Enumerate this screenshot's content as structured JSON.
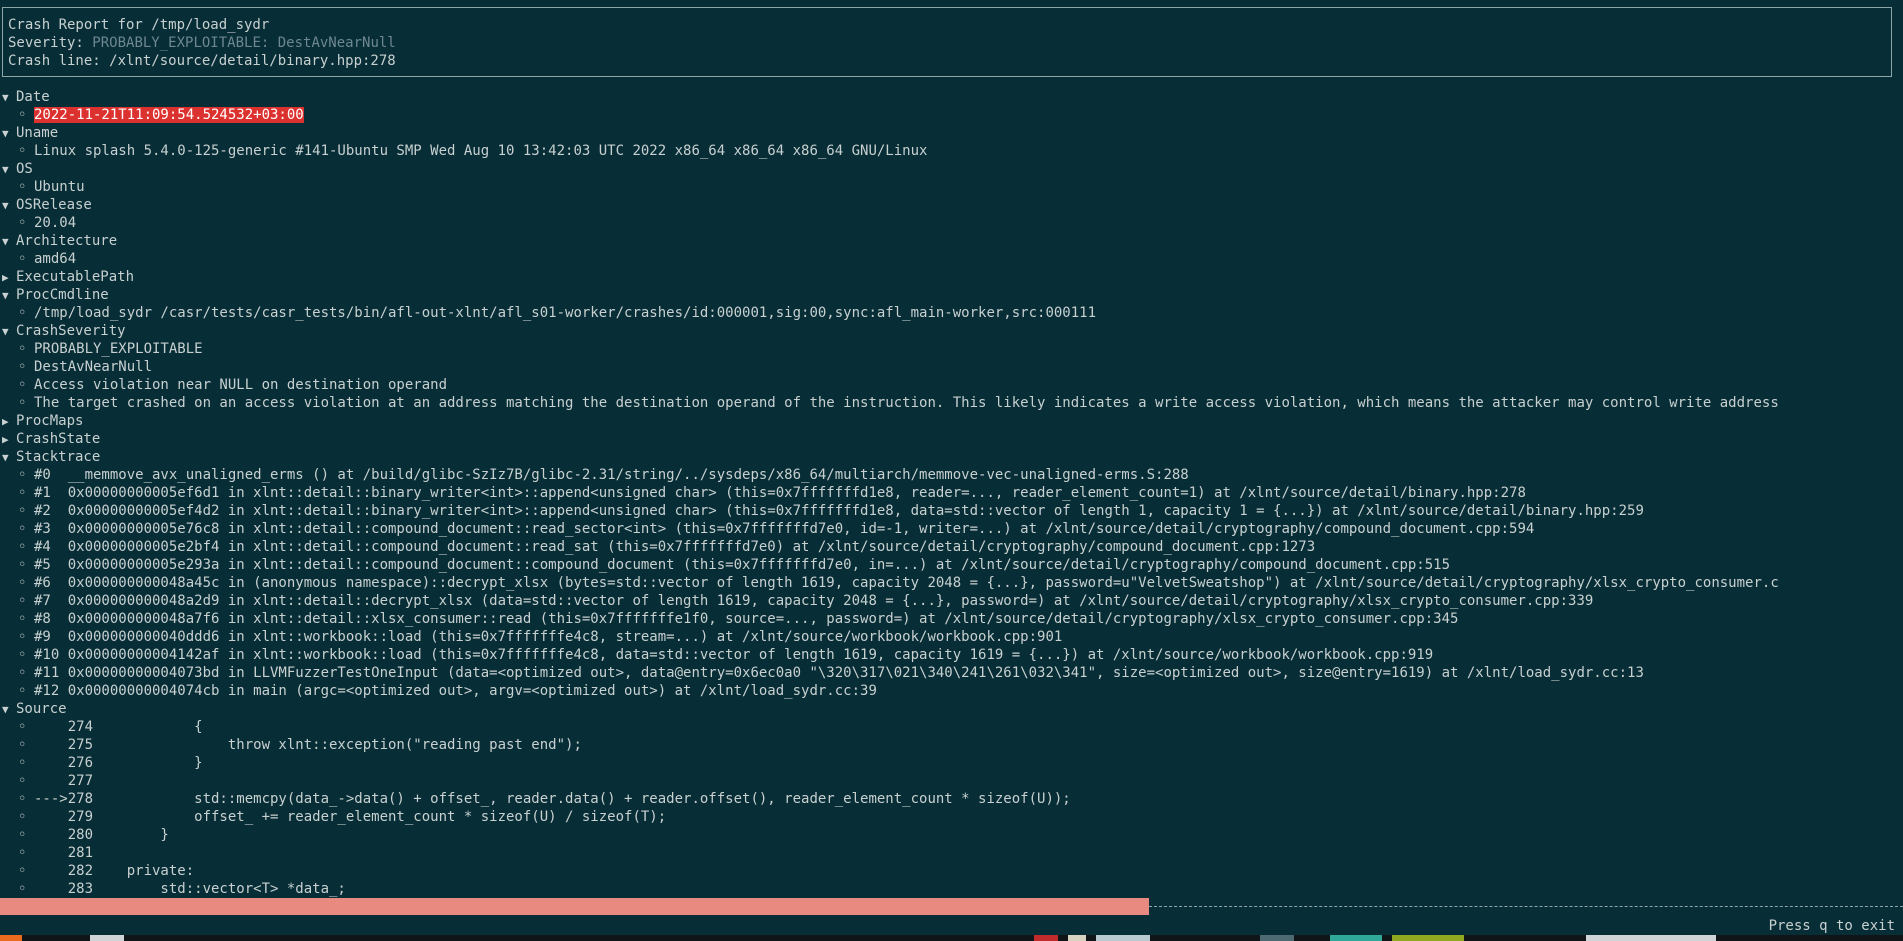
{
  "header": {
    "title": "Crash Report for /tmp/load_sydr",
    "severity_label": "Severity: ",
    "severity_value": "PROBABLY_EXPLOITABLE: DestAvNearNull",
    "crash_line": "Crash line: /xlnt/source/detail/binary.hpp:278"
  },
  "sections": {
    "date": {
      "label": "Date",
      "expanded": true,
      "items": [
        "2022-11-21T11:09:54.524532+03:00"
      ]
    },
    "uname": {
      "label": "Uname",
      "expanded": true,
      "items": [
        "Linux splash 5.4.0-125-generic #141-Ubuntu SMP Wed Aug 10 13:42:03 UTC 2022 x86_64 x86_64 x86_64 GNU/Linux"
      ]
    },
    "os": {
      "label": "OS",
      "expanded": true,
      "items": [
        "Ubuntu"
      ]
    },
    "osrelease": {
      "label": "OSRelease",
      "expanded": true,
      "items": [
        "20.04"
      ]
    },
    "architecture": {
      "label": "Architecture",
      "expanded": true,
      "items": [
        "amd64"
      ]
    },
    "executablepath": {
      "label": "ExecutablePath",
      "expanded": false,
      "items": []
    },
    "proccmdline": {
      "label": "ProcCmdline",
      "expanded": true,
      "items": [
        "/tmp/load_sydr /casr/tests/casr_tests/bin/afl-out-xlnt/afl_s01-worker/crashes/id:000001,sig:00,sync:afl_main-worker,src:000111"
      ]
    },
    "crashseverity": {
      "label": "CrashSeverity",
      "expanded": true,
      "items": [
        "PROBABLY_EXPLOITABLE",
        "DestAvNearNull",
        "Access violation near NULL on destination operand",
        "The target crashed on an access violation at an address matching the destination operand of the instruction. This likely indicates a write access violation, which means the attacker may control write address"
      ]
    },
    "procmaps": {
      "label": "ProcMaps",
      "expanded": false,
      "items": []
    },
    "crashstate": {
      "label": "CrashState",
      "expanded": false,
      "items": []
    },
    "stacktrace": {
      "label": "Stacktrace",
      "expanded": true,
      "items": [
        "#0  __memmove_avx_unaligned_erms () at /build/glibc-SzIz7B/glibc-2.31/string/../sysdeps/x86_64/multiarch/memmove-vec-unaligned-erms.S:288",
        "#1  0x00000000005ef6d1 in xlnt::detail::binary_writer<int>::append<unsigned char> (this=0x7fffffffd1e8, reader=..., reader_element_count=1) at /xlnt/source/detail/binary.hpp:278",
        "#2  0x00000000005ef4d2 in xlnt::detail::binary_writer<int>::append<unsigned char> (this=0x7fffffffd1e8, data=std::vector of length 1, capacity 1 = {...}) at /xlnt/source/detail/binary.hpp:259",
        "#3  0x00000000005e76c8 in xlnt::detail::compound_document::read_sector<int> (this=0x7fffffffd7e0, id=-1, writer=...) at /xlnt/source/detail/cryptography/compound_document.cpp:594",
        "#4  0x00000000005e2bf4 in xlnt::detail::compound_document::read_sat (this=0x7fffffffd7e0) at /xlnt/source/detail/cryptography/compound_document.cpp:1273",
        "#5  0x00000000005e293a in xlnt::detail::compound_document::compound_document (this=0x7fffffffd7e0, in=...) at /xlnt/source/detail/cryptography/compound_document.cpp:515",
        "#6  0x000000000048a45c in (anonymous namespace)::decrypt_xlsx (bytes=std::vector of length 1619, capacity 2048 = {...}, password=u\"VelvetSweatshop\") at /xlnt/source/detail/cryptography/xlsx_crypto_consumer.c",
        "#7  0x000000000048a2d9 in xlnt::detail::decrypt_xlsx (data=std::vector of length 1619, capacity 2048 = {...}, password=) at /xlnt/source/detail/cryptography/xlsx_crypto_consumer.cpp:339",
        "#8  0x000000000048a7f6 in xlnt::detail::xlsx_consumer::read (this=0x7fffffffe1f0, source=..., password=) at /xlnt/source/detail/cryptography/xlsx_crypto_consumer.cpp:345",
        "#9  0x000000000040ddd6 in xlnt::workbook::load (this=0x7fffffffe4c8, stream=...) at /xlnt/source/workbook/workbook.cpp:901",
        "#10 0x00000000004142af in xlnt::workbook::load (this=0x7fffffffe4c8, data=std::vector of length 1619, capacity 1619 = {...}) at /xlnt/source/workbook/workbook.cpp:919",
        "#11 0x00000000004073bd in LLVMFuzzerTestOneInput (data=<optimized out>, data@entry=0x6ec0a0 \"\\320\\317\\021\\340\\241\\261\\032\\341\", size=<optimized out>, size@entry=1619) at /xlnt/load_sydr.cc:13",
        "#12 0x00000000004074cb in main (argc=<optimized out>, argv=<optimized out>) at /xlnt/load_sydr.cc:39"
      ]
    },
    "source": {
      "label": "Source",
      "expanded": true,
      "items": [
        "    274            {",
        "    275                throw xlnt::exception(\"reading past end\");",
        "    276            }",
        "    277",
        "--->278            std::memcpy(data_->data() + offset_, reader.data() + reader.offset(), reader_element_count * sizeof(U));",
        "    279            offset_ += reader_element_count * sizeof(U) / sizeof(T);",
        "    280        }",
        "    281",
        "    282    private:",
        "    283        std::vector<T> *data_;"
      ]
    }
  },
  "icons": {
    "expanded": "▼",
    "collapsed": "▶",
    "bullet": "◦"
  },
  "colors": {
    "background": "#072d36",
    "text": "#c8d0d0",
    "highlight": "#dc322f",
    "progress_fill": "#e98a80"
  },
  "footer": {
    "scroll_progress": 0.732,
    "exit_hint": "Press q to exit"
  }
}
